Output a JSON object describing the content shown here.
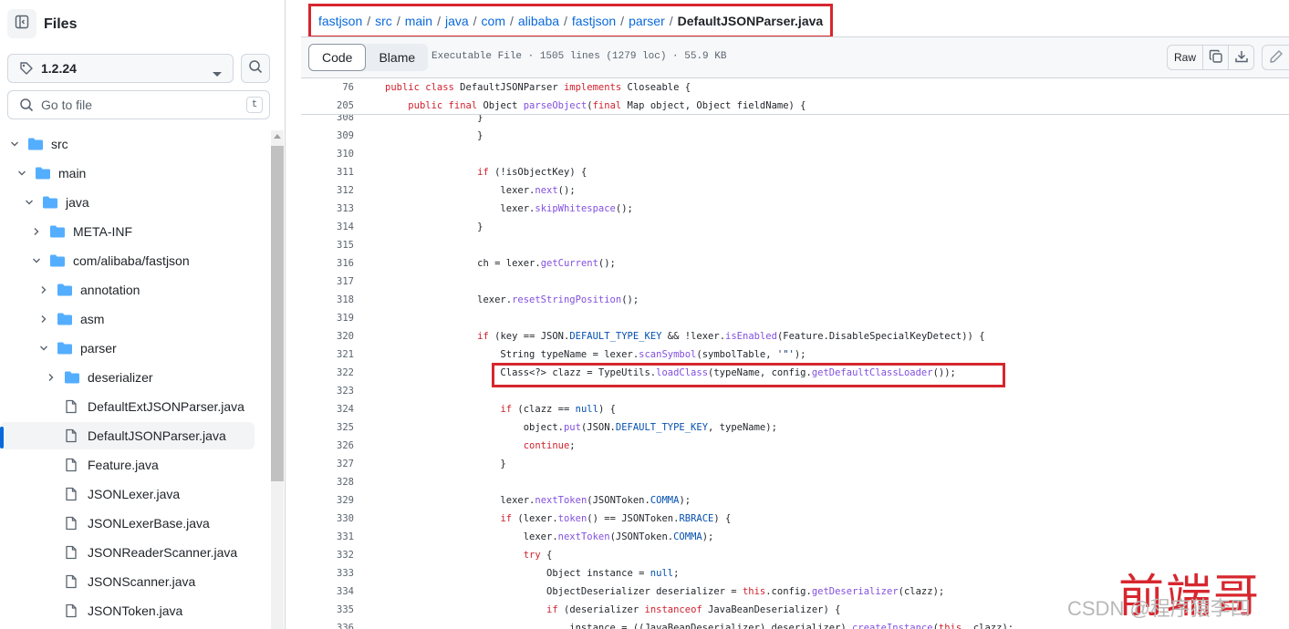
{
  "sidebar": {
    "title": "Files",
    "branch": "1.2.24",
    "goto_placeholder": "Go to file",
    "goto_shortcut": "t",
    "tree": [
      {
        "label": "src",
        "type": "folder",
        "depth": 0,
        "open": true
      },
      {
        "label": "main",
        "type": "folder",
        "depth": 1,
        "open": true
      },
      {
        "label": "java",
        "type": "folder",
        "depth": 2,
        "open": true
      },
      {
        "label": "META-INF",
        "type": "folder",
        "depth": 3,
        "open": false
      },
      {
        "label": "com/alibaba/fastjson",
        "type": "folder",
        "depth": 3,
        "open": true
      },
      {
        "label": "annotation",
        "type": "folder",
        "depth": 4,
        "open": false
      },
      {
        "label": "asm",
        "type": "folder",
        "depth": 4,
        "open": false
      },
      {
        "label": "parser",
        "type": "folder",
        "depth": 4,
        "open": true
      },
      {
        "label": "deserializer",
        "type": "folder",
        "depth": 5,
        "open": false
      },
      {
        "label": "DefaultExtJSONParser.java",
        "type": "file",
        "depth": 5
      },
      {
        "label": "DefaultJSONParser.java",
        "type": "file",
        "depth": 5,
        "active": true
      },
      {
        "label": "Feature.java",
        "type": "file",
        "depth": 5
      },
      {
        "label": "JSONLexer.java",
        "type": "file",
        "depth": 5
      },
      {
        "label": "JSONLexerBase.java",
        "type": "file",
        "depth": 5
      },
      {
        "label": "JSONReaderScanner.java",
        "type": "file",
        "depth": 5
      },
      {
        "label": "JSONScanner.java",
        "type": "file",
        "depth": 5
      },
      {
        "label": "JSONToken.java",
        "type": "file",
        "depth": 5
      }
    ]
  },
  "breadcrumb": {
    "parts": [
      "fastjson",
      "src",
      "main",
      "java",
      "com",
      "alibaba",
      "fastjson",
      "parser"
    ],
    "separator": "/",
    "current": "DefaultJSONParser.java"
  },
  "toolbar": {
    "code_tab": "Code",
    "blame_tab": "Blame",
    "file_info": "Executable File · 1505 lines (1279 loc) · 55.9 KB",
    "raw_label": "Raw"
  },
  "sticky_lines": [
    {
      "n": "76",
      "html": "<span class=\"k\">public class</span> DefaultJSONParser <span class=\"k\">implements</span> Closeable {"
    },
    {
      "n": "205",
      "html": "    <span class=\"k\">public final</span> Object <span class=\"f\">parseObject</span>(<span class=\"k\">final</span> Map object, Object fieldName) {"
    }
  ],
  "code_lines": [
    {
      "n": "308",
      "html": "                }"
    },
    {
      "n": "309",
      "html": "                }"
    },
    {
      "n": "310",
      "html": ""
    },
    {
      "n": "311",
      "html": "                <span class=\"k\">if</span> (!isObjectKey) {"
    },
    {
      "n": "312",
      "html": "                    lexer.<span class=\"f\">next</span>();"
    },
    {
      "n": "313",
      "html": "                    lexer.<span class=\"f\">skipWhitespace</span>();"
    },
    {
      "n": "314",
      "html": "                }"
    },
    {
      "n": "315",
      "html": ""
    },
    {
      "n": "316",
      "html": "                ch = lexer.<span class=\"f\">getCurrent</span>();"
    },
    {
      "n": "317",
      "html": ""
    },
    {
      "n": "318",
      "html": "                lexer.<span class=\"f\">resetStringPosition</span>();"
    },
    {
      "n": "319",
      "html": ""
    },
    {
      "n": "320",
      "html": "                <span class=\"k\">if</span> (key == JSON.<span class=\"c\">DEFAULT_TYPE_KEY</span> &amp;&amp; !lexer.<span class=\"f\">isEnabled</span>(Feature.DisableSpecialKeyDetect)) {"
    },
    {
      "n": "321",
      "html": "                    String typeName = lexer.<span class=\"f\">scanSymbol</span>(symbolTable, <span class=\"s\">'\"'</span>);"
    },
    {
      "n": "322",
      "html": "                    Class&lt;?&gt; clazz = TypeUtils.<span class=\"f\">loadClass</span>(typeName, config.<span class=\"f\">getDefaultClassLoader</span>());"
    },
    {
      "n": "323",
      "html": ""
    },
    {
      "n": "324",
      "html": "                    <span class=\"k\">if</span> (clazz == <span class=\"c\">null</span>) {"
    },
    {
      "n": "325",
      "html": "                        object.<span class=\"f\">put</span>(JSON.<span class=\"c\">DEFAULT_TYPE_KEY</span>, typeName);"
    },
    {
      "n": "326",
      "html": "                        <span class=\"k\">continue</span>;"
    },
    {
      "n": "327",
      "html": "                    }"
    },
    {
      "n": "328",
      "html": ""
    },
    {
      "n": "329",
      "html": "                    lexer.<span class=\"f\">nextToken</span>(JSONToken.<span class=\"c\">COMMA</span>);"
    },
    {
      "n": "330",
      "html": "                    <span class=\"k\">if</span> (lexer.<span class=\"f\">token</span>() == JSONToken.<span class=\"c\">RBRACE</span>) {"
    },
    {
      "n": "331",
      "html": "                        lexer.<span class=\"f\">nextToken</span>(JSONToken.<span class=\"c\">COMMA</span>);"
    },
    {
      "n": "332",
      "html": "                        <span class=\"k\">try</span> {"
    },
    {
      "n": "333",
      "html": "                            Object instance = <span class=\"c\">null</span>;"
    },
    {
      "n": "334",
      "html": "                            ObjectDeserializer deserializer = <span class=\"k\">this</span>.config.<span class=\"f\">getDeserializer</span>(clazz);"
    },
    {
      "n": "335",
      "html": "                            <span class=\"k\">if</span> (deserializer <span class=\"k\">instanceof</span> JavaBeanDeserializer) {"
    },
    {
      "n": "336",
      "html": "                                instance = ((JavaBeanDeserializer) deserializer).<span class=\"f\">createInstance</span>(<span class=\"k\">this</span>, clazz);"
    }
  ],
  "watermark": {
    "text": "前端哥",
    "sub": "CSDN @程序猿李四"
  }
}
